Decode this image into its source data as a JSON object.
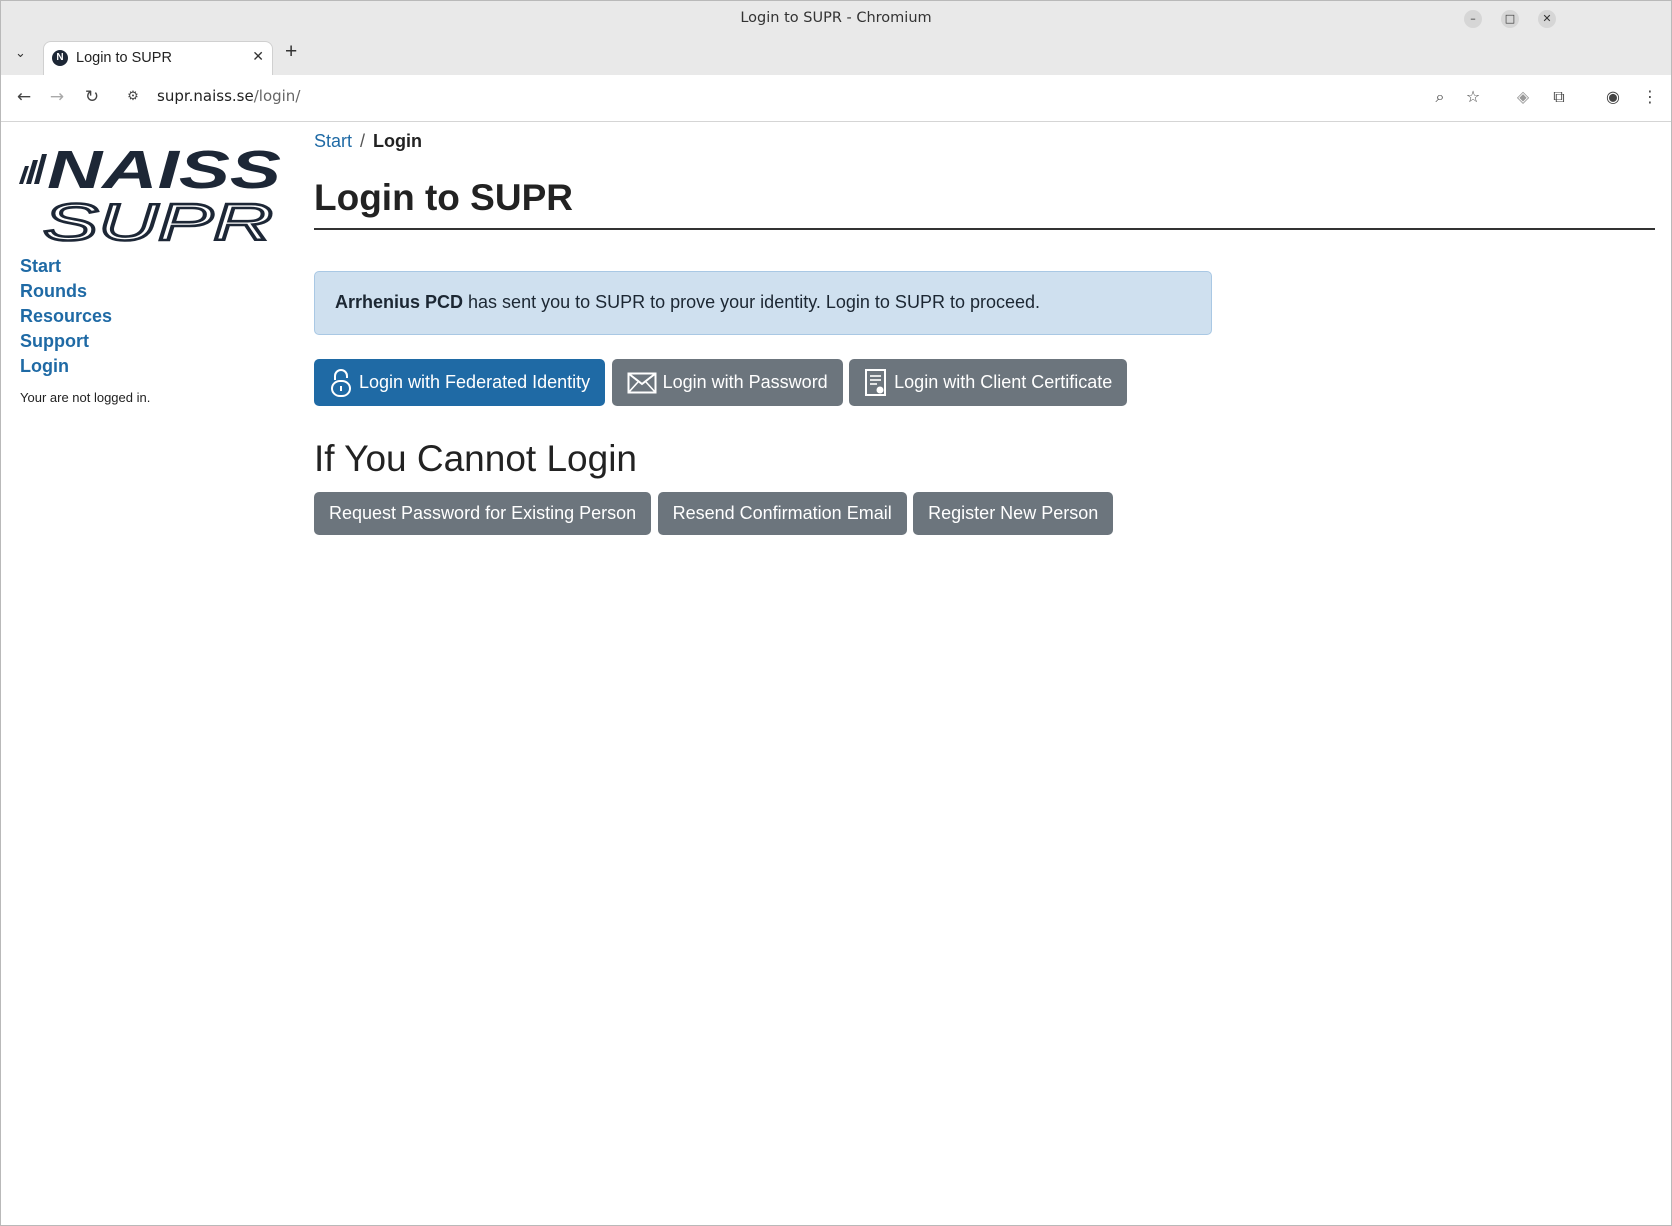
{
  "window": {
    "title": "Login to SUPR - Chromium"
  },
  "tabs": [
    {
      "label": "Login to SUPR",
      "favicon": "N"
    }
  ],
  "addressbar": {
    "host": "supr.naiss.se",
    "path": "/login/"
  },
  "sidebar": {
    "logo_text": [
      "NAISS",
      "SUPR"
    ],
    "nav": [
      {
        "label": "Start"
      },
      {
        "label": "Rounds"
      },
      {
        "label": "Resources"
      },
      {
        "label": "Support"
      },
      {
        "label": "Login"
      }
    ],
    "status": "Your are not logged in."
  },
  "breadcrumb": {
    "start": "Start",
    "sep": "/",
    "current": "Login"
  },
  "main": {
    "title": "Login to SUPR",
    "alert": {
      "bold": "Arrhenius PCD",
      "text": " has sent you to SUPR to prove your identity. Login to SUPR to proceed."
    },
    "login_buttons": [
      {
        "label": "Login with Federated Identity",
        "icon": "lock-icon"
      },
      {
        "label": "Login with Password",
        "icon": "envelope-icon"
      },
      {
        "label": "Login with Client Certificate",
        "icon": "certificate-icon"
      }
    ],
    "help_title": "If You Cannot Login",
    "help_buttons": [
      {
        "label": "Request Password for Existing Person"
      },
      {
        "label": "Resend Confirmation Email"
      },
      {
        "label": "Register New Person"
      }
    ]
  },
  "colors": {
    "link": "#1f6aa5",
    "primary": "#1f6aa5",
    "secondary": "#6c757d",
    "alert_bg": "#cfe0ef"
  }
}
